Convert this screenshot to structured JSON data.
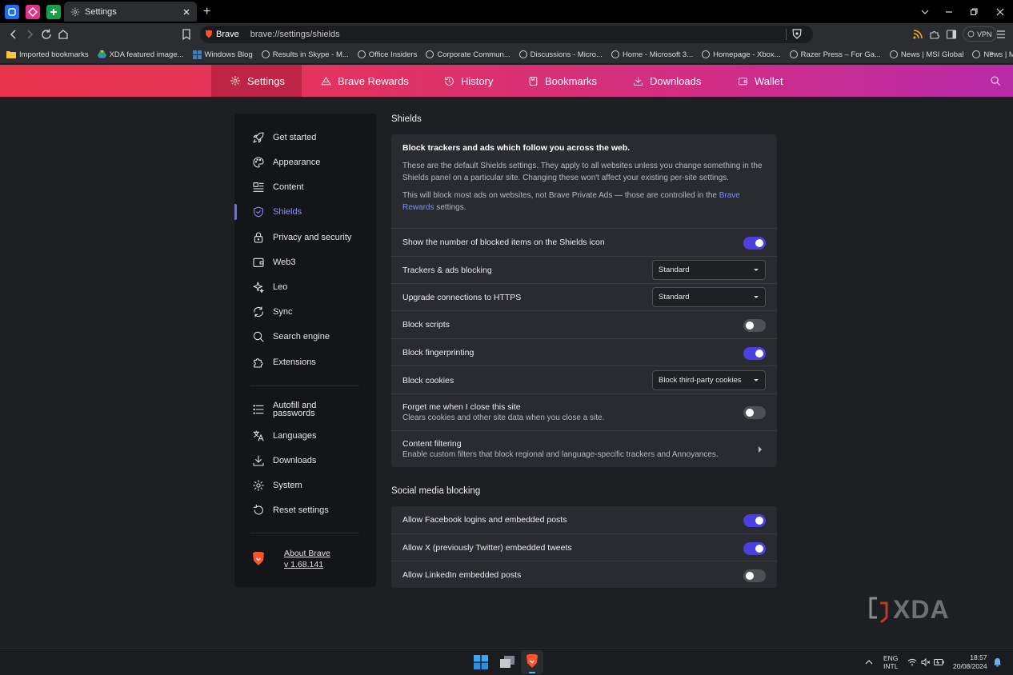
{
  "browser": {
    "tab_title": "Settings",
    "omnibox_brand": "Brave",
    "omnibox_url": "brave://settings/shields",
    "vpn_label": "VPN"
  },
  "bookmarks": [
    "Imported bookmarks",
    "XDA featured image...",
    "Windows Blog",
    "Results in Skype - M...",
    "Office Insiders",
    "Corporate Commun...",
    "Discussions - Micro...",
    "Home - Microsoft 3...",
    "Homepage - Xbox...",
    "Razer Press – For Ga...",
    "News | MSI Global",
    "News | MSI USA"
  ],
  "topnav": [
    {
      "label": "Settings",
      "icon": "gear-icon"
    },
    {
      "label": "Brave Rewards",
      "icon": "rewards-icon"
    },
    {
      "label": "History",
      "icon": "history-icon"
    },
    {
      "label": "Bookmarks",
      "icon": "bookmarks-icon"
    },
    {
      "label": "Downloads",
      "icon": "download-icon"
    },
    {
      "label": "Wallet",
      "icon": "wallet-icon"
    }
  ],
  "sidebar": {
    "items": [
      "Get started",
      "Appearance",
      "Content",
      "Shields",
      "Privacy and security",
      "Web3",
      "Leo",
      "Sync",
      "Search engine",
      "Extensions",
      "Autofill and passwords",
      "Languages",
      "Downloads",
      "System",
      "Reset settings"
    ],
    "active": "Shields",
    "about_label": "About Brave",
    "version": "v 1.68.141"
  },
  "shields": {
    "section_title": "Shields",
    "intro_heading": "Block trackers and ads which follow you across the web.",
    "intro_p1": "These are the default Shields settings. They apply to all websites unless you change something in the Shields panel on a particular site. Changing these won't affect your existing per-site settings.",
    "intro_p2_a": "This will block most ads on websites, not Brave Private Ads — those are controlled in the ",
    "intro_p2_link": "Brave Rewards",
    "intro_p2_b": " settings.",
    "rows": {
      "show_count": {
        "label": "Show the number of blocked items on the Shields icon",
        "on": true
      },
      "trackers": {
        "label": "Trackers & ads blocking",
        "value": "Standard"
      },
      "https": {
        "label": "Upgrade connections to HTTPS",
        "value": "Standard"
      },
      "scripts": {
        "label": "Block scripts",
        "on": false
      },
      "fingerprinting": {
        "label": "Block fingerprinting",
        "on": true
      },
      "cookies": {
        "label": "Block cookies",
        "value": "Block third-party cookies"
      },
      "forget": {
        "label": "Forget me when I close this site",
        "sub": "Clears cookies and other site data when you close a site.",
        "on": false
      },
      "filtering": {
        "label": "Content filtering",
        "sub": "Enable custom filters that block regional and language-specific trackers and Annoyances."
      }
    }
  },
  "social": {
    "section_title": "Social media blocking",
    "facebook": {
      "label": "Allow Facebook logins and embedded posts",
      "on": true
    },
    "x": {
      "label": "Allow X (previously Twitter) embedded tweets",
      "on": true
    },
    "linkedin": {
      "label": "Allow LinkedIn embedded posts",
      "on": false
    }
  },
  "watermark": "XDA",
  "taskbar": {
    "lang_1": "ENG",
    "lang_2": "INTL",
    "time": "18:57",
    "date": "20/08/2024"
  },
  "colors": {
    "accent": "#4a3fe0",
    "nav_gradient_start": "#e8334c",
    "nav_gradient_end": "#b72aa8",
    "sidebar_active": "#8c8ff5"
  }
}
